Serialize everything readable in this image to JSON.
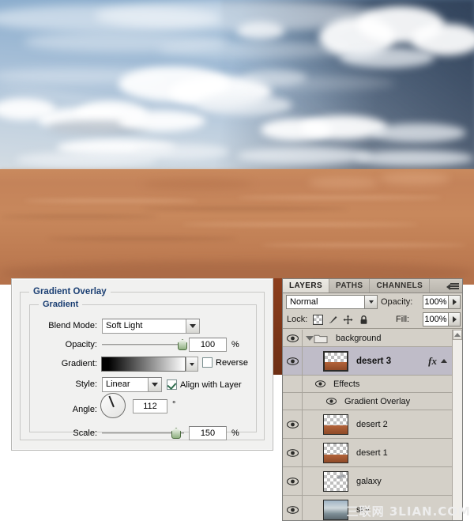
{
  "canvas": {
    "description": "desert landscape under cloudy sky"
  },
  "gradient_dialog": {
    "section_title": "Gradient Overlay",
    "group_title": "Gradient",
    "blend_mode_label": "Blend Mode:",
    "blend_mode_value": "Soft Light",
    "opacity_label": "Opacity:",
    "opacity_value": "100",
    "opacity_unit": "%",
    "gradient_label": "Gradient:",
    "reverse_label": "Reverse",
    "reverse_checked": false,
    "style_label": "Style:",
    "style_value": "Linear",
    "align_label": "Align with Layer",
    "align_checked": true,
    "angle_label": "Angle:",
    "angle_value": "112",
    "angle_unit": "°",
    "scale_label": "Scale:",
    "scale_value": "150",
    "scale_unit": "%",
    "title_color": "#1b3f73"
  },
  "layers_panel": {
    "tabs": [
      {
        "label": "LAYERS",
        "active": true
      },
      {
        "label": "PATHS",
        "active": false
      },
      {
        "label": "CHANNELS",
        "active": false
      }
    ],
    "blend_mode": "Normal",
    "opacity_label": "Opacity:",
    "opacity_value": "100%",
    "lock_label": "Lock:",
    "lock_icons": [
      "lock-transparency-icon",
      "lock-image-icon",
      "lock-position-icon",
      "lock-all-icon"
    ],
    "fill_label": "Fill:",
    "fill_value": "100%",
    "rows": [
      {
        "name": "background",
        "type": "group",
        "visible": true,
        "selected": false,
        "expanded": true,
        "thumb": "folder"
      },
      {
        "name": "desert 3",
        "type": "layer",
        "visible": true,
        "selected": true,
        "has_fx": true,
        "thumb": "sand"
      },
      {
        "name": "Effects",
        "type": "effects-header",
        "visible": true,
        "selected": false,
        "thumb": "none"
      },
      {
        "name": "Gradient Overlay",
        "type": "effect",
        "visible": true,
        "selected": false,
        "thumb": "none"
      },
      {
        "name": "desert 2",
        "type": "layer",
        "visible": true,
        "selected": false,
        "has_fx": false,
        "thumb": "sand"
      },
      {
        "name": "desert 1",
        "type": "layer",
        "visible": true,
        "selected": false,
        "has_fx": false,
        "thumb": "sand-thin"
      },
      {
        "name": "galaxy",
        "type": "layer",
        "visible": true,
        "selected": false,
        "has_fx": false,
        "thumb": "empty"
      },
      {
        "name": "sky",
        "type": "layer",
        "visible": true,
        "selected": false,
        "has_fx": false,
        "thumb": "sky"
      }
    ]
  },
  "watermark": {
    "text": "三联网 3LIAN.COM"
  }
}
